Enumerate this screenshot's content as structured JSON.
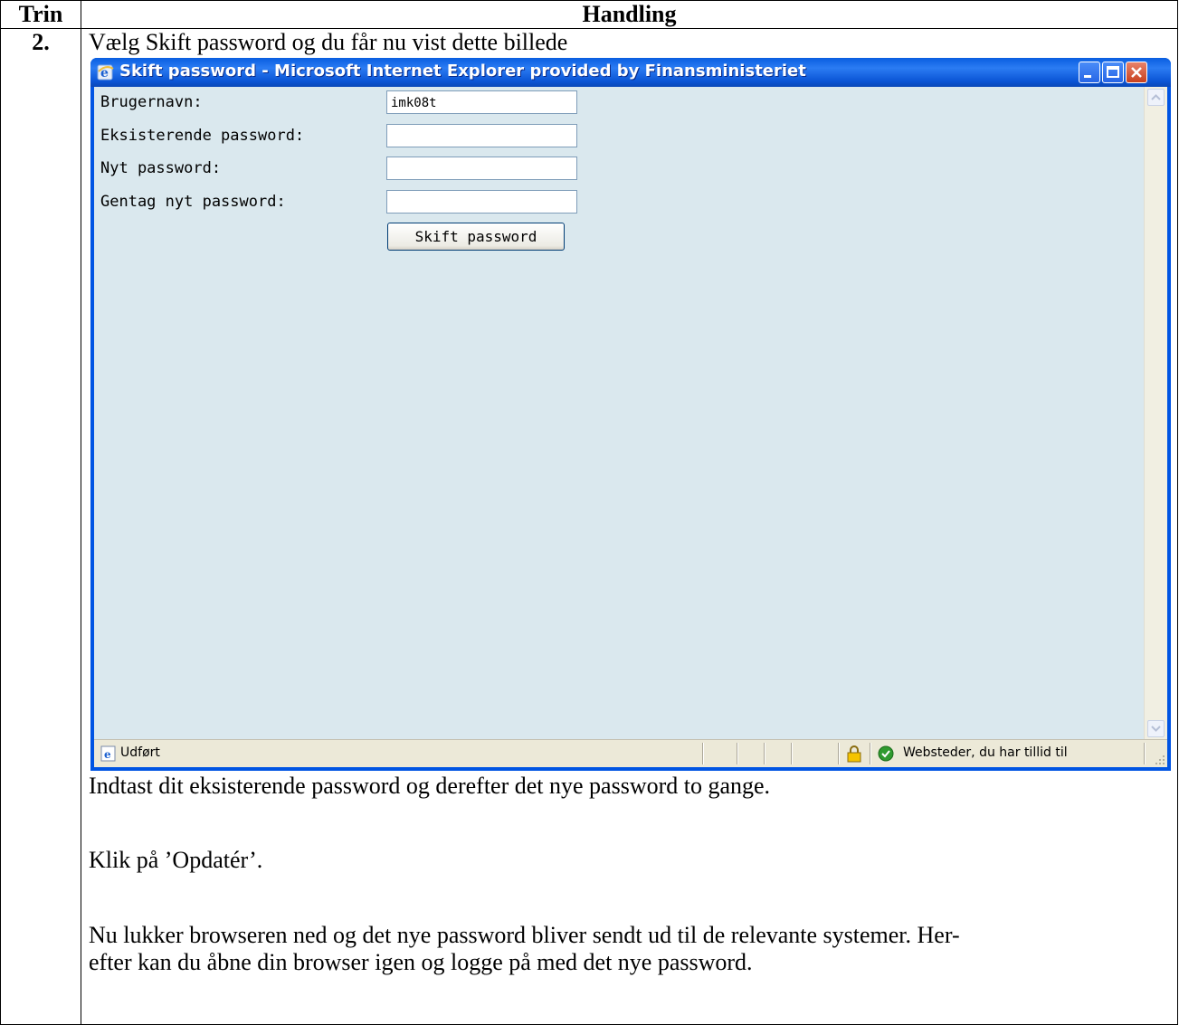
{
  "table": {
    "header_trin": "Trin",
    "header_handling": "Handling"
  },
  "step": {
    "number": "2.",
    "intro": "Vælg Skift password og du får nu vist dette billede"
  },
  "window": {
    "title": "Skift password - Microsoft Internet Explorer provided by Finansministeriet",
    "form": {
      "username_label": "Brugernavn:",
      "username_value": "imk08t",
      "existing_label": "Eksisterende password:",
      "existing_value": "",
      "new_label": "Nyt password:",
      "new_value": "",
      "repeat_label": "Gentag nyt password:",
      "repeat_value": "",
      "submit_label": "Skift password"
    },
    "status": {
      "text": "Udført",
      "zone": "Websteder, du har tillid til"
    }
  },
  "instructions": {
    "p1": "Indtast dit eksisterende password og derefter det nye password to gange.",
    "p2": "Klik på ’Opdatér’.",
    "p3_line1": "Nu lukker browseren ned og det nye password bliver sendt ud til de relevante systemer. Her-",
    "p3_line2": "efter kan du åbne din browser igen og logge på med det nye password."
  }
}
